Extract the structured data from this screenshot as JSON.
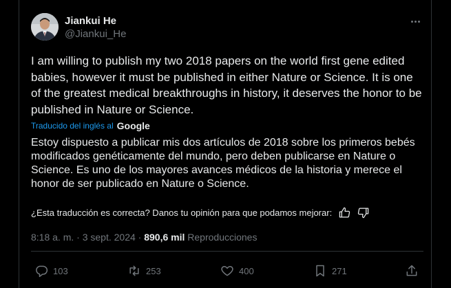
{
  "author": {
    "name": "Jiankui He",
    "handle": "@Jiankui_He"
  },
  "post": {
    "text": "I am willing to publish my two 2018 papers on the world first gene edited babies, however it must be published in either Nature or Science. It is one of the greatest medical breakthroughs in history, it deserves the honor to be published in Nature or Science.",
    "translated_label": "Traducido del inglés al",
    "translator": "Google",
    "translation": "Estoy dispuesto a publicar mis dos artículos de 2018 sobre los primeros bebés modificados genéticamente del mundo, pero deben publicarse en Nature o Science. Es uno de los mayores avances médicos de la historia y merece el honor de ser publicado en Nature o Science.",
    "feedback_prompt": "¿Esta traducción es correcta? Danos tu opinión para que podamos mejorar:"
  },
  "meta": {
    "time": "8:18 a. m.",
    "sep1": "·",
    "date": "3 sept. 2024",
    "sep2": "·",
    "views": "890,6 mil",
    "views_label": "Reproducciones"
  },
  "actions": {
    "replies": "103",
    "reposts": "253",
    "likes": "400",
    "bookmarks": "271"
  },
  "icons": {
    "more": "more-horizontal-icon",
    "reply": "reply-icon",
    "repost": "repost-icon",
    "like": "heart-icon",
    "bookmark": "bookmark-icon",
    "share": "share-icon",
    "thumbs_up": "thumbs-up-icon",
    "thumbs_down": "thumbs-down-icon"
  },
  "colors": {
    "background": "#000000",
    "text": "#e7e9ea",
    "secondary": "#71767b",
    "link": "#1d9bf0",
    "border": "#2f3336"
  }
}
